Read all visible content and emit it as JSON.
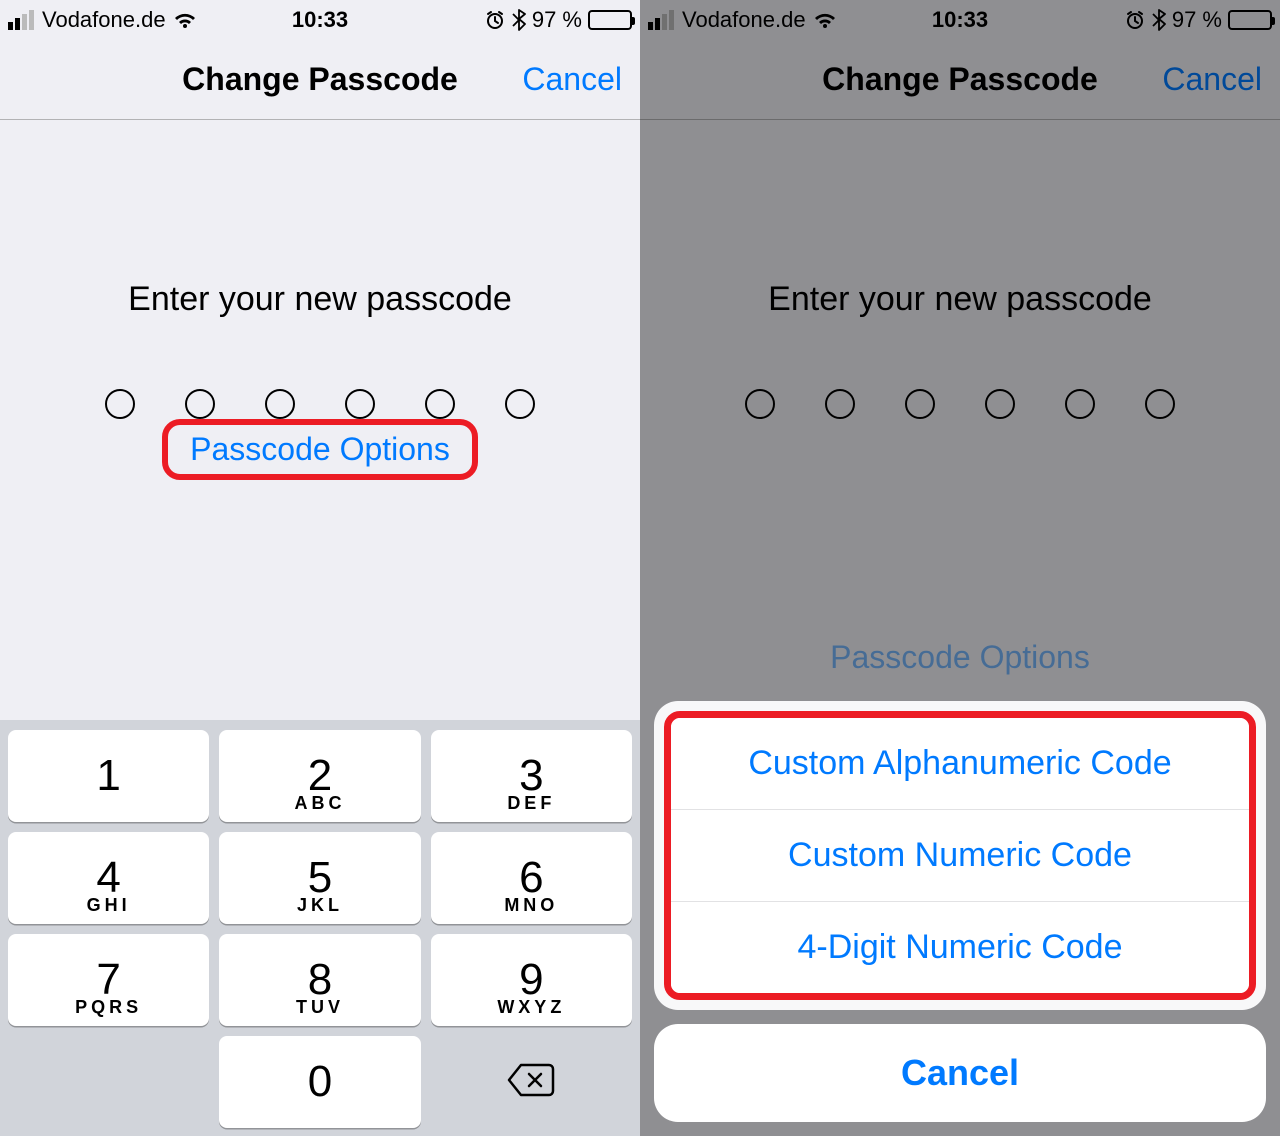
{
  "status": {
    "carrier": "Vodafone.de",
    "time": "10:33",
    "battery_pct": "97 %",
    "battery_fill_pct": 97
  },
  "nav": {
    "title": "Change Passcode",
    "cancel": "Cancel"
  },
  "main": {
    "prompt": "Enter your new passcode",
    "passcode_length": 6,
    "options_label": "Passcode Options"
  },
  "keypad": {
    "keys": [
      {
        "num": "1",
        "letters": ""
      },
      {
        "num": "2",
        "letters": "ABC"
      },
      {
        "num": "3",
        "letters": "DEF"
      },
      {
        "num": "4",
        "letters": "GHI"
      },
      {
        "num": "5",
        "letters": "JKL"
      },
      {
        "num": "6",
        "letters": "MNO"
      },
      {
        "num": "7",
        "letters": "PQRS"
      },
      {
        "num": "8",
        "letters": "TUV"
      },
      {
        "num": "9",
        "letters": "WXYZ"
      },
      {
        "num": "0",
        "letters": ""
      }
    ]
  },
  "action_sheet": {
    "options": [
      "Custom Alphanumeric Code",
      "Custom Numeric Code",
      "4-Digit Numeric Code"
    ],
    "cancel": "Cancel"
  }
}
